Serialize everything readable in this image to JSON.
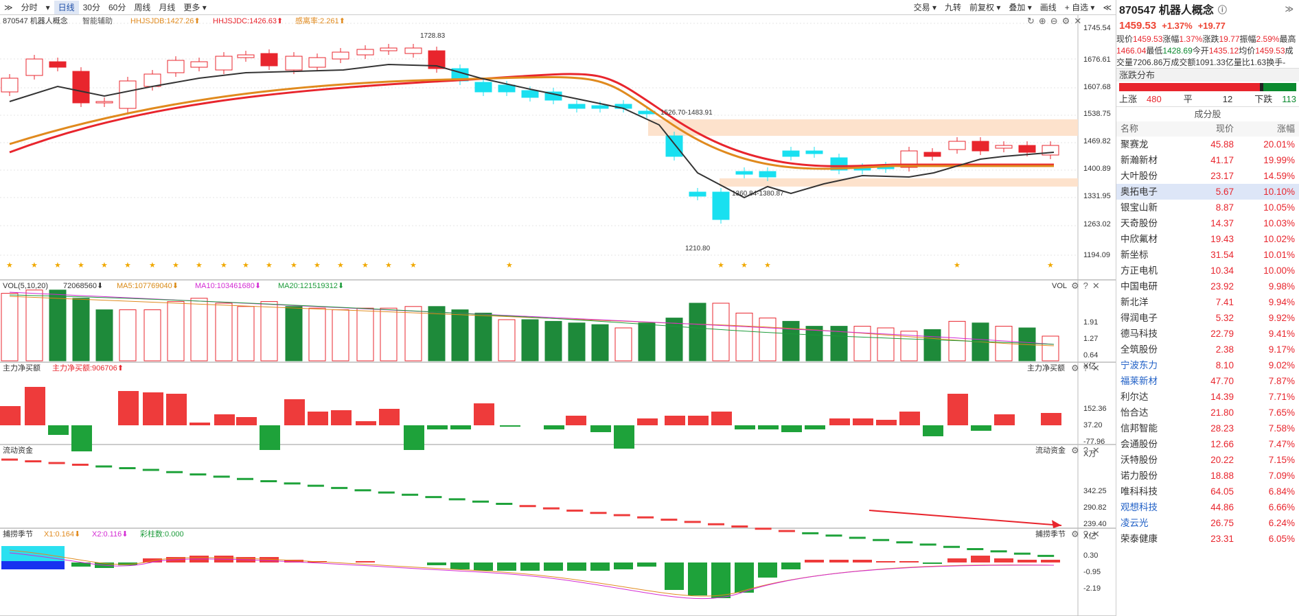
{
  "toolbar": {
    "left": [
      "≫",
      "分时",
      "▾",
      "日线",
      "30分",
      "60分",
      "周线",
      "月线",
      "更多 ▾"
    ],
    "right": [
      "交易 ▾",
      "九转",
      "前复权 ▾",
      "叠加 ▾",
      "画线",
      "+ 自选 ▾",
      "≪"
    ],
    "active": "日线"
  },
  "price_panel": {
    "code_name": "870547 机器人概念",
    "assist": "智能辅助",
    "hhjsjdb": "HHJSJDB:1427.26⬆",
    "hhjsjdc": "HHJSJDC:1426.63⬆",
    "rise_rate": "感离率:2.261⬆",
    "ticks": [
      "1745.54",
      "1676.61",
      "1607.68",
      "1538.75",
      "1469.82",
      "1400.89",
      "1331.95",
      "1263.02",
      "1194.09"
    ],
    "ann_high": "1728.83",
    "ann_range1": "1526.70-1483.91",
    "ann_range2": "1360.84-1380.87",
    "ann_low": "1210.80"
  },
  "vol_panel": {
    "title": "VOL(5,10,20)",
    "val": "72068560⬇",
    "ma5": "MA5:107769040⬇",
    "ma10": "MA10:103461680⬇",
    "ma20": "MA20:121519312⬇",
    "right_label": "VOL",
    "ticks": [
      "1.91",
      "1.27",
      "0.64"
    ],
    "unit": "X亿"
  },
  "flow_panel": {
    "title": "主力净买额",
    "val": "主力净买额:906706⬆",
    "right_label": "主力净买额",
    "ticks": [
      "152.36",
      "37.20",
      "-77.96"
    ],
    "unit": "X万"
  },
  "liq_panel": {
    "title": "流动资金",
    "right_label": "流动资金",
    "ticks": [
      "342.25",
      "290.82",
      "239.40"
    ],
    "unit": "X亿"
  },
  "osc_panel": {
    "title": "捕捞季节",
    "x1": "X1:0.164⬇",
    "x2": "X2:0.116⬇",
    "bar": "彩柱数:0.000",
    "right_label": "捕捞季节",
    "ticks": [
      "0.30",
      "-0.95",
      "-2.19"
    ]
  },
  "quote": {
    "title": "870547 机器人概念",
    "price": "1459.53",
    "pct": "+1.37%",
    "chg": "+19.77",
    "rows": [
      [
        "现价",
        "1459.53",
        "涨幅",
        "1.37%"
      ],
      [
        "涨跌",
        "19.77",
        "振幅",
        "2.59%"
      ],
      [
        "最高",
        "1466.04",
        "最低",
        "1428.69"
      ],
      [
        "今开",
        "1435.12",
        "均价",
        "1459.53"
      ],
      [
        "成交量",
        "7206.86万",
        "成交额",
        "1091.33亿"
      ],
      [
        "量比",
        "1.63",
        "换手",
        "-"
      ]
    ]
  },
  "distribution": {
    "title": "涨跌分布",
    "up_label": "上涨",
    "up": "480",
    "flat_label": "平",
    "flat": "12",
    "down_label": "下跌",
    "down": "113"
  },
  "constituents": {
    "title": "成分股",
    "headers": [
      "名称",
      "现价",
      "涨幅"
    ],
    "rows": [
      [
        "聚赛龙",
        "45.88",
        "20.01%"
      ],
      [
        "新瀚新材",
        "41.17",
        "19.99%"
      ],
      [
        "大叶股份",
        "23.17",
        "14.59%"
      ],
      [
        "奥拓电子",
        "5.67",
        "10.10%"
      ],
      [
        "银宝山新",
        "8.87",
        "10.05%"
      ],
      [
        "天奇股份",
        "14.37",
        "10.03%"
      ],
      [
        "中欣氟材",
        "19.43",
        "10.02%"
      ],
      [
        "新坐标",
        "31.54",
        "10.01%"
      ],
      [
        "方正电机",
        "10.34",
        "10.00%"
      ],
      [
        "中国电研",
        "23.92",
        "9.98%"
      ],
      [
        "新北洋",
        "7.41",
        "9.94%"
      ],
      [
        "得润电子",
        "5.32",
        "9.92%"
      ],
      [
        "德马科技",
        "22.79",
        "9.41%"
      ],
      [
        "全筑股份",
        "2.38",
        "9.17%"
      ],
      [
        "宁波东力",
        "8.10",
        "9.02%"
      ],
      [
        "福莱新材",
        "47.70",
        "7.87%"
      ],
      [
        "利尔达",
        "14.39",
        "7.71%"
      ],
      [
        "怡合达",
        "21.80",
        "7.65%"
      ],
      [
        "信邦智能",
        "28.23",
        "7.58%"
      ],
      [
        "会通股份",
        "12.66",
        "7.47%"
      ],
      [
        "沃特股份",
        "20.22",
        "7.15%"
      ],
      [
        "诺力股份",
        "18.88",
        "7.09%"
      ],
      [
        "唯科科技",
        "64.05",
        "6.84%"
      ],
      [
        "观想科技",
        "44.86",
        "6.66%"
      ],
      [
        "凌云光",
        "26.75",
        "6.24%"
      ],
      [
        "荣泰健康",
        "23.31",
        "6.05%"
      ]
    ],
    "blue_names": [
      "宁波东力",
      "福莱新材",
      "观想科技",
      "凌云光"
    ],
    "selected": "奥拓电子"
  }
}
